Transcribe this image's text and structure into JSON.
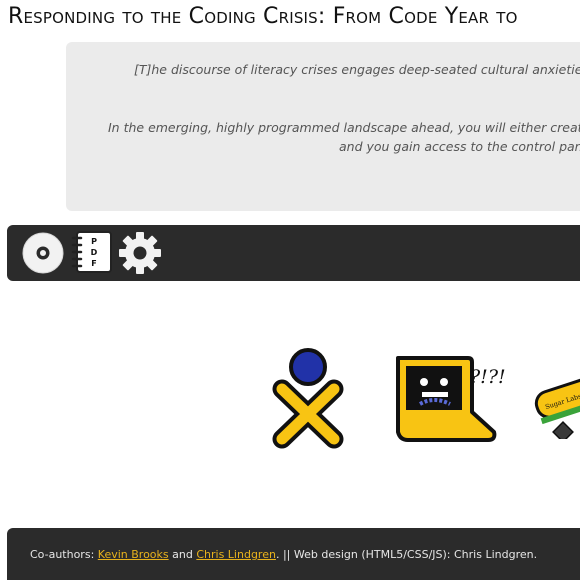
{
  "header": {
    "title": "Responding to the Coding Crisis: From Code Year to"
  },
  "quotes": {
    "quote_1": "[T]he discourse of literacy crises engages deep-seated cultural anxieties and",
    "quote_2_line_1": "In the emerging, highly programmed landscape ahead, you will either create the so",
    "quote_2_line_2": "and you gain access to the control panel o"
  },
  "toolbar": {
    "items": [
      {
        "icon": "cd-icon"
      },
      {
        "icon": "pdf-icon",
        "letters": [
          "P",
          "D",
          "F"
        ]
      },
      {
        "icon": "gear-icon"
      }
    ]
  },
  "stage": {
    "exclaim": "?!?!",
    "badge_text": "Sugar Labs"
  },
  "footer": {
    "coauthors_label": "Co-authors:",
    "author_1": "Kevin Brooks",
    "and_text": "and",
    "author_2": "Chris Lindgren",
    "design_credit": ". || Web design (HTML5/CSS/JS): Chris Lindgren."
  },
  "colors": {
    "toolbar_bg": "#2b2b2b",
    "quote_bg": "#ebebeb",
    "xo_blue": "#2132a8",
    "xo_yellow": "#f8c413",
    "link": "#e8b21c"
  }
}
